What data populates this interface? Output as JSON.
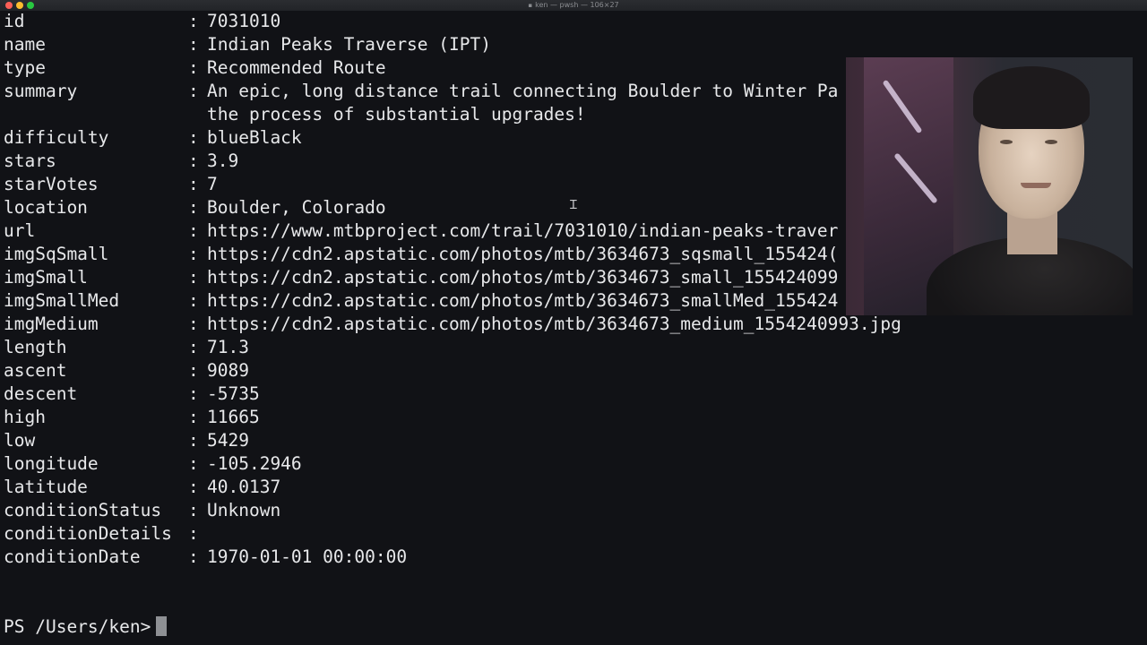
{
  "window": {
    "title": "ken — pwsh — 106×27"
  },
  "rows": [
    {
      "key": "id",
      "sep": ":",
      "value": "7031010"
    },
    {
      "key": "name",
      "sep": ":",
      "value": "Indian Peaks Traverse (IPT)"
    },
    {
      "key": "type",
      "sep": ":",
      "value": "Recommended Route"
    },
    {
      "key": "summary",
      "sep": ":",
      "value": "An epic, long distance trail connecting Boulder to Winter Pa"
    },
    {
      "key": "",
      "sep": "",
      "value": "the process of substantial upgrades!"
    },
    {
      "key": "difficulty",
      "sep": ":",
      "value": "blueBlack"
    },
    {
      "key": "stars",
      "sep": ":",
      "value": "3.9"
    },
    {
      "key": "starVotes",
      "sep": ":",
      "value": "7"
    },
    {
      "key": "location",
      "sep": ":",
      "value": "Boulder, Colorado"
    },
    {
      "key": "url",
      "sep": ":",
      "value": "https://www.mtbproject.com/trail/7031010/indian-peaks-traver"
    },
    {
      "key": "imgSqSmall",
      "sep": ":",
      "value": "https://cdn2.apstatic.com/photos/mtb/3634673_sqsmall_155424("
    },
    {
      "key": "imgSmall",
      "sep": ":",
      "value": "https://cdn2.apstatic.com/photos/mtb/3634673_small_155424099"
    },
    {
      "key": "imgSmallMed",
      "sep": ":",
      "value": "https://cdn2.apstatic.com/photos/mtb/3634673_smallMed_155424"
    },
    {
      "key": "imgMedium",
      "sep": ":",
      "value": "https://cdn2.apstatic.com/photos/mtb/3634673_medium_1554240993.jpg"
    },
    {
      "key": "length",
      "sep": ":",
      "value": "71.3"
    },
    {
      "key": "ascent",
      "sep": ":",
      "value": "9089"
    },
    {
      "key": "descent",
      "sep": ":",
      "value": "-5735"
    },
    {
      "key": "high",
      "sep": ":",
      "value": "11665"
    },
    {
      "key": "low",
      "sep": ":",
      "value": "5429"
    },
    {
      "key": "longitude",
      "sep": ":",
      "value": "-105.2946"
    },
    {
      "key": "latitude",
      "sep": ":",
      "value": "40.0137"
    },
    {
      "key": "conditionStatus",
      "sep": ":",
      "value": "Unknown"
    },
    {
      "key": "conditionDetails",
      "sep": ":",
      "value": ""
    },
    {
      "key": "conditionDate",
      "sep": ":",
      "value": "1970-01-01 00:00:00"
    }
  ],
  "prompt": {
    "text": "PS /Users/ken>"
  },
  "colors": {
    "background": "#111216",
    "foreground": "#e7e8ea",
    "cursor": "#8e9094"
  },
  "overlay": {
    "icon": "person-photo"
  }
}
